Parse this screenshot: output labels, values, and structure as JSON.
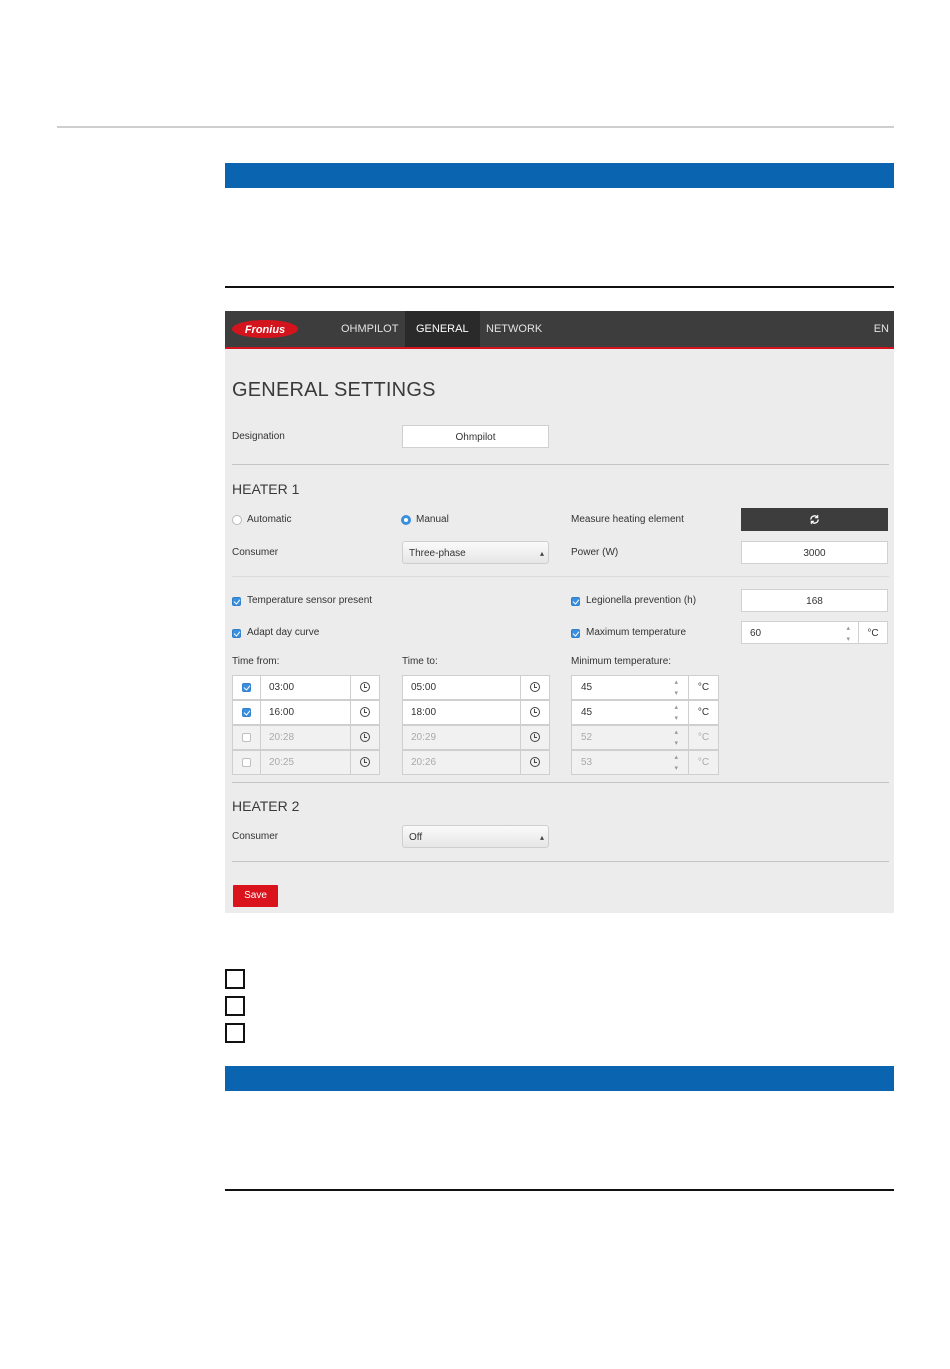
{
  "nav": {
    "logo_text": "Fronius",
    "items": [
      "OHMPILOT",
      "GENERAL",
      "NETWORK"
    ],
    "active": "GENERAL",
    "language": "EN",
    "accent": "#d4141c"
  },
  "general": {
    "title": "GENERAL SETTINGS",
    "designation_label": "Designation",
    "designation_value": "Ohmpilot"
  },
  "heater1": {
    "title": "HEATER 1",
    "mode_automatic": "Automatic",
    "mode_manual": "Manual",
    "mode_selected": "Manual",
    "measure_label": "Measure heating element",
    "consumer_label": "Consumer",
    "consumer_value": "Three-phase",
    "power_label": "Power (W)",
    "power_value": "3000",
    "temp_sensor_label": "Temperature sensor present",
    "legionella_label": "Legionella prevention (h)",
    "legionella_value": "168",
    "adapt_label": "Adapt day curve",
    "max_temp_label": "Maximum temperature",
    "max_temp_value": "60",
    "unit": "°C",
    "time_from_label": "Time from:",
    "time_to_label": "Time to:",
    "min_temp_label": "Minimum temperature:",
    "rows": [
      {
        "enabled": true,
        "from": "03:00",
        "to": "05:00",
        "min": "45"
      },
      {
        "enabled": true,
        "from": "16:00",
        "to": "18:00",
        "min": "45"
      },
      {
        "enabled": false,
        "from": "20:28",
        "to": "20:29",
        "min": "52"
      },
      {
        "enabled": false,
        "from": "20:25",
        "to": "20:26",
        "min": "53"
      }
    ]
  },
  "heater2": {
    "title": "HEATER 2",
    "consumer_label": "Consumer",
    "consumer_value": "Off"
  },
  "save_label": "Save",
  "colors": {
    "header_blue": "#0b64b0",
    "checkbox_blue": "#3b8fdd",
    "save_red": "#d9121c"
  }
}
